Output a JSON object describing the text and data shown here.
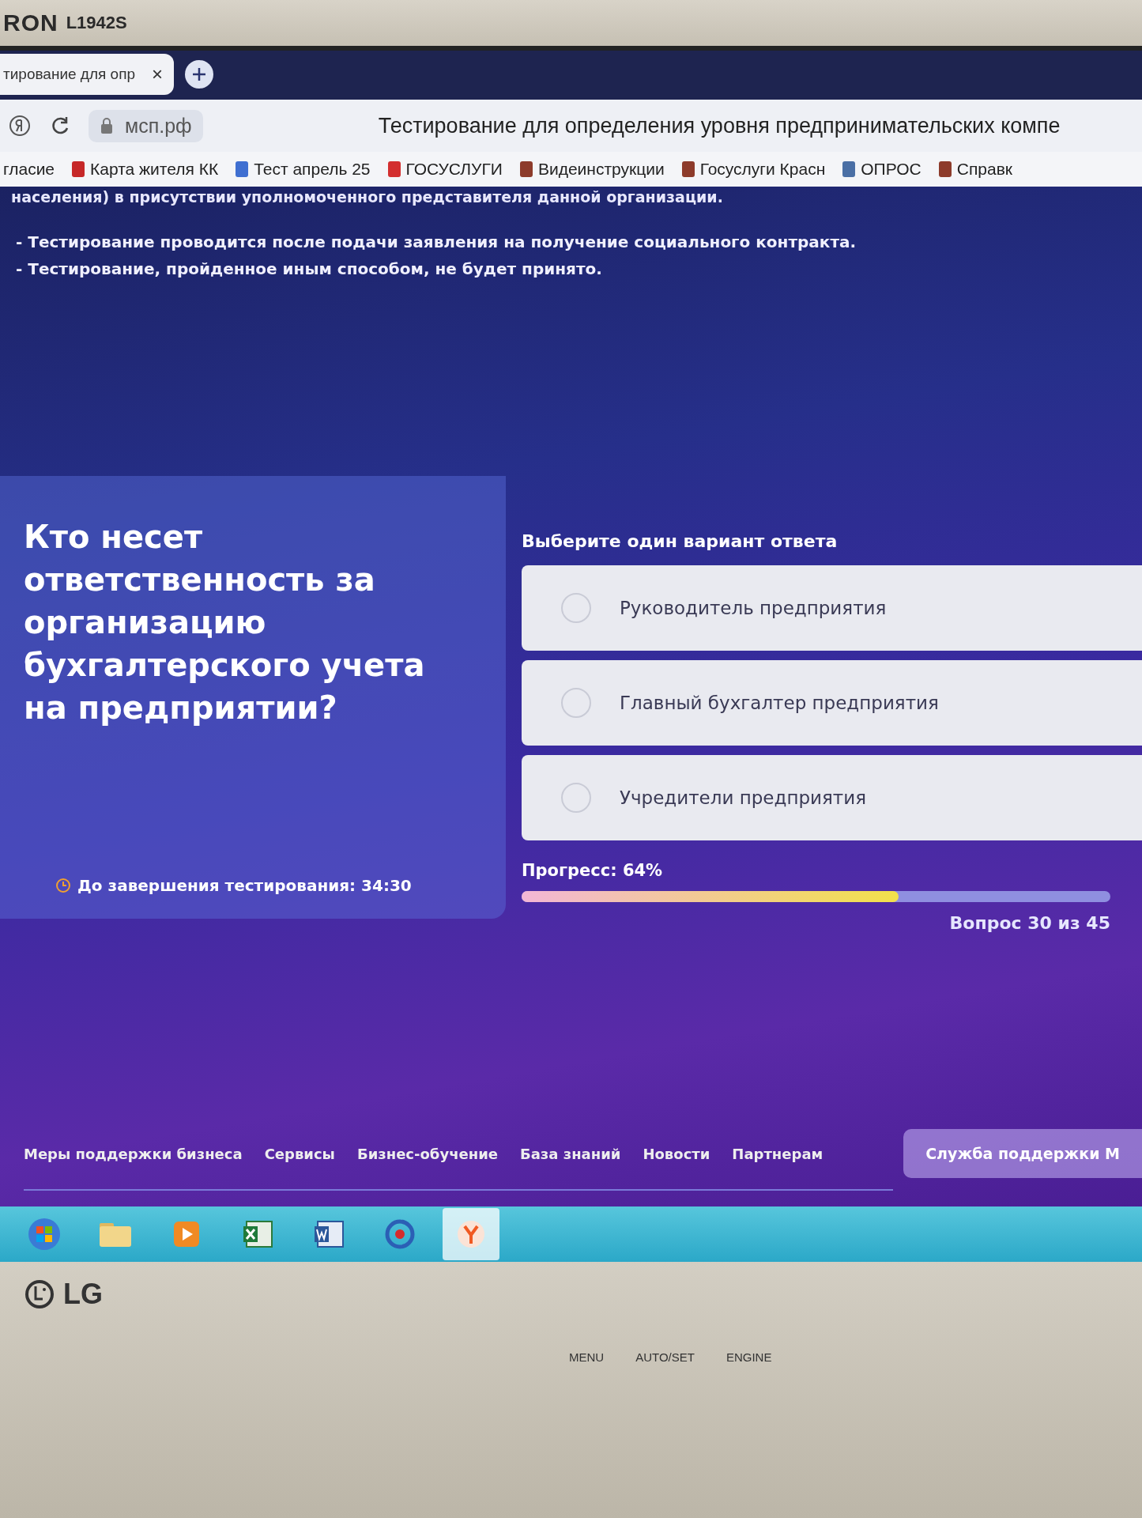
{
  "monitor": {
    "brand": "RON",
    "model": "L1942S",
    "logo": "LG",
    "buttons": [
      "MENU",
      "AUTO/SET",
      "ENGINE"
    ]
  },
  "browser": {
    "tab": {
      "title": "тирование для опр",
      "close": "×"
    },
    "address": {
      "domain": "мсп.рф",
      "title": "Тестирование для определения уровня предпринимательских компе"
    },
    "bookmarks": [
      {
        "label": "гласие"
      },
      {
        "label": "Карта жителя КК",
        "color": "#c62828"
      },
      {
        "label": "Тест апрель 25",
        "color": "#3f6fd1"
      },
      {
        "label": "ГОСУСЛУГИ",
        "color": "#d32f2f"
      },
      {
        "label": "Видеинструкции",
        "color": "#8d3b2b"
      },
      {
        "label": "Госуслуги Красн",
        "color": "#8d3b2b"
      },
      {
        "label": "ОПРОС",
        "color": "#4a6fa5"
      },
      {
        "label": "Справк",
        "color": "#8d3b2b"
      }
    ]
  },
  "page": {
    "notice": "населения) в присутствии уполномоченного представителя данной организации.",
    "rules": [
      "- Тестирование проводится после подачи заявления на получение социального контракта.",
      "- Тестирование, пройденное иным способом, не будет принято."
    ],
    "question": "Кто несет ответственность за организацию бухгалтерского учета на предприятии?",
    "timer": "До завершения тестирования: 34:30",
    "instruction": "Выберите один вариант ответа",
    "options": [
      {
        "label": "Руководитель предприятия",
        "selected": false
      },
      {
        "label": "Главный бухгалтер предприятия",
        "selected": false
      },
      {
        "label": "Учредители предприятия",
        "selected": false
      }
    ],
    "progress": {
      "label": "Прогресс: 64%",
      "level": 0.64,
      "counter": "Вопрос 30 из 45"
    },
    "footer_links": [
      "Меры поддержки бизнеса",
      "Сервисы",
      "Бизнес-обучение",
      "База знаний",
      "Новости",
      "Партнерам"
    ],
    "support_button": "Служба поддержки М"
  },
  "taskbar": [
    {
      "kind": "start",
      "selected": false
    },
    {
      "kind": "folder",
      "selected": false
    },
    {
      "kind": "media",
      "selected": false
    },
    {
      "kind": "sheet",
      "selected": false
    },
    {
      "kind": "doc",
      "selected": false
    },
    {
      "kind": "ring",
      "selected": false
    },
    {
      "kind": "browser",
      "selected": true
    }
  ]
}
